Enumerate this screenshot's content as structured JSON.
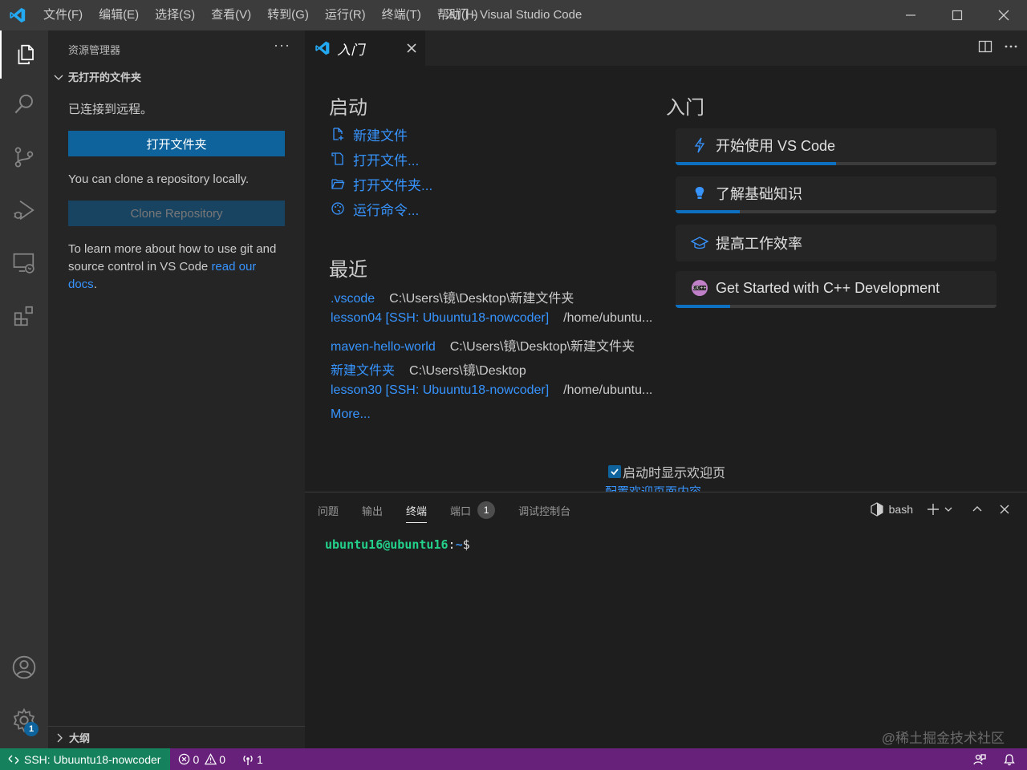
{
  "app": {
    "title": "入门 - Visual Studio Code",
    "menu": [
      "文件(F)",
      "编辑(E)",
      "选择(S)",
      "查看(V)",
      "转到(G)",
      "运行(R)",
      "终端(T)",
      "帮助(H)"
    ]
  },
  "activity": {
    "settings_badge": "1"
  },
  "sidebar": {
    "header": "资源管理器",
    "more": "···",
    "section": "无打开的文件夹",
    "connected_text": "已连接到远程。",
    "open_folder_label": "打开文件夹",
    "clone_text": "You can clone a repository locally.",
    "clone_button": "Clone Repository",
    "learn_text": "To learn more about how to use git and source control in VS Code ",
    "learn_link": "read our docs",
    "learn_end": ".",
    "outline": "大纲"
  },
  "tabs": {
    "active_label": "入门"
  },
  "welcome": {
    "start_heading": "启动",
    "start_items": [
      "新建文件",
      "打开文件...",
      "打开文件夹...",
      "运行命令..."
    ],
    "recent_heading": "最近",
    "recent": [
      {
        "name": ".vscode",
        "path": "C:\\Users\\镜\\Desktop\\新建文件夹"
      },
      {
        "name": "lesson04 [SSH: Ubuuntu18-nowcoder]",
        "path": "/home/ubuntu..."
      },
      {
        "name": "maven-hello-world",
        "path": "C:\\Users\\镜\\Desktop\\新建文件夹"
      },
      {
        "name": "新建文件夹",
        "path": "C:\\Users\\镜\\Desktop"
      },
      {
        "name": "lesson30 [SSH: Ubuuntu18-nowcoder]",
        "path": "/home/ubuntu..."
      }
    ],
    "more_label": "More...",
    "walkthrough_heading": "入门",
    "walkthroughs": [
      {
        "label": "开始使用 VS Code",
        "progress": 0.5
      },
      {
        "label": "了解基础知识",
        "progress": 0.2
      },
      {
        "label": "提高工作效率",
        "progress": 0
      },
      {
        "label": "Get Started with C++ Development",
        "progress": 0.17
      }
    ],
    "startup_checkbox": "启动时显示欢迎页",
    "configure_link": "配置欢迎页面内容"
  },
  "panel": {
    "tabs": [
      "问题",
      "输出",
      "终端",
      "端口",
      "调试控制台"
    ],
    "ports_badge": "1",
    "shell": "bash",
    "terminal": {
      "user": "ubuntu16@ubuntu16",
      "sep": ":",
      "path": "~",
      "prompt": "$"
    },
    "watermark": "@稀土掘金技术社区"
  },
  "status": {
    "remote": "SSH: Ubuuntu18-nowcoder",
    "errors": "0",
    "warnings": "0",
    "ports": "1"
  },
  "colors": {
    "accent": "#0e639c",
    "link": "#3794ff",
    "statusbar": "#68217a",
    "remote": "#16825d"
  }
}
